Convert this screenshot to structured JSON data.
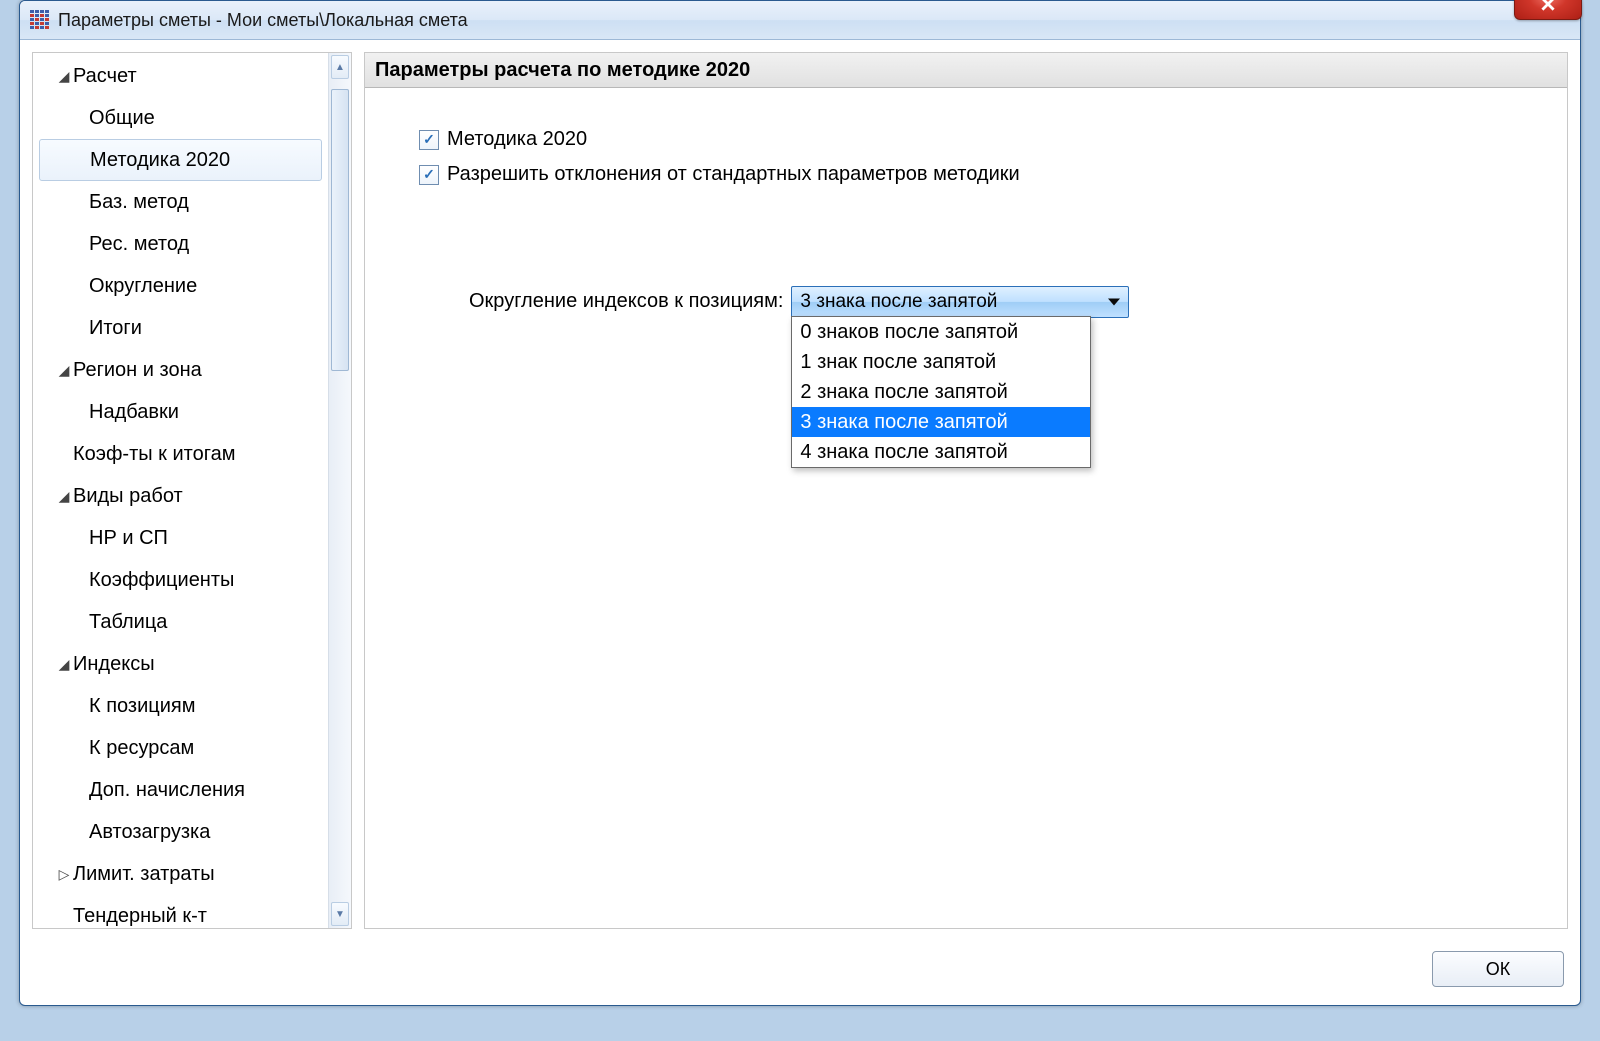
{
  "title": "Параметры сметы - Мои сметы\\Локальная смета",
  "tree": {
    "raschet": "Расчет",
    "obshie": "Общие",
    "metodika2020": "Методика 2020",
    "bazmetod": "Баз. метод",
    "resmetod": "Рес. метод",
    "okruglenie": "Округление",
    "itogi": "Итоги",
    "regionzona": "Регион и зона",
    "nadbavki": "Надбавки",
    "koefitogam": "Коэф-ты к итогам",
    "vidyrabot": "Виды работ",
    "nrsp": "НР и СП",
    "koefficienty": "Коэффициенты",
    "tablica": "Таблица",
    "indeksy": "Индексы",
    "kpoziciyam": "К позициям",
    "kresursam": "К ресурсам",
    "dopnachisleniya": "Доп. начисления",
    "avtozagruzka": "Автозагрузка",
    "limitzatraty": "Лимит. затраты",
    "tenderkt": "Тендерный к-т"
  },
  "panel": {
    "header": "Параметры расчета по методике 2020",
    "check1": "Методика 2020",
    "check2": "Разрешить отклонения от стандартных параметров методики",
    "roundingLabel": "Округление индексов к позициям:",
    "roundingSelected": "3 знака после запятой",
    "roundingOptions": {
      "o0": "0 знаков после запятой",
      "o1": "1 знак после запятой",
      "o2": "2 знака после запятой",
      "o3": "3 знака после запятой",
      "o4": "4 знака после запятой"
    }
  },
  "buttons": {
    "ok": "ОК"
  }
}
